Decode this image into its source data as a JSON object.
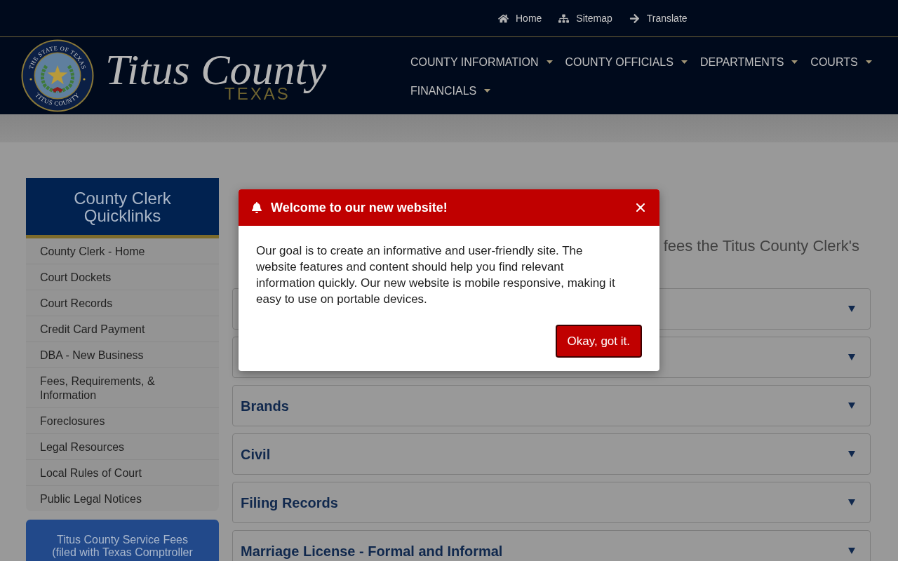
{
  "top_links": [
    "Home",
    "Sitemap",
    "Translate"
  ],
  "logo": {
    "seal_top": "THE STATE OF TEXAS",
    "seal_bottom": "TITUS COUNTY",
    "name": "Titus County",
    "state": "TEXAS"
  },
  "nav": [
    "COUNTY INFORMATION",
    "COUNTY OFFICIALS",
    "DEPARTMENTS",
    "COURTS",
    "FINANCIALS"
  ],
  "sidebar": {
    "title": "County Clerk Quicklinks",
    "links": [
      "County Clerk - Home",
      "Court Dockets",
      "Court Records",
      "Credit Card Payment",
      "DBA - New Business",
      "Fees, Requirements, & Information",
      "Foreclosures",
      "Legal Resources",
      "Local Rules of Court",
      "Public Legal Notices"
    ],
    "callout": "Titus County Service Fees (filed with Texas Comptroller"
  },
  "main": {
    "intro": {
      "lines": [
        {
          "end": "fees the Titus County Clerk's"
        }
      ]
    },
    "accordion": [
      {
        "expanded": false
      },
      {
        "expanded": false
      },
      {
        "title": "Brands",
        "expanded": false
      },
      {
        "title": "Civil",
        "expanded": false
      },
      {
        "title": "Filing Records",
        "expanded": false
      },
      {
        "title": "Marriage License - Formal and Informal",
        "expanded": false
      }
    ]
  },
  "modal": {
    "title": "Welcome to our new website!",
    "body": "Our goal is to create an informative and user-friendly site. The website features and content should help you find relevant information quickly. Our new website is mobile responsive, making it easy to use on portable devices.",
    "button": "Okay, got it."
  }
}
